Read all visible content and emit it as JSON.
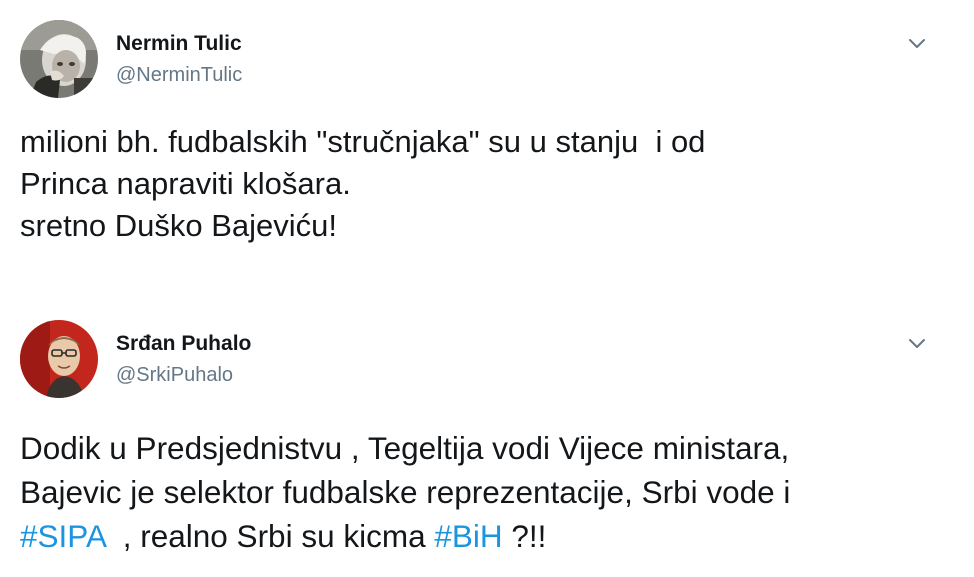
{
  "tweets": [
    {
      "name": "Nermin Tulic",
      "handle": "@NerminTulic",
      "lines": [
        "milioni bh. fudbalskih \"stručnjaka\" su u stanju  i od",
        "Princa napraviti klošara.",
        "sretno Duško Bajeviću!"
      ],
      "menu_icon": "chevron-down-icon"
    },
    {
      "name": "Srđan Puhalo",
      "handle": "@SrkiPuhalo",
      "lines": [
        "Dodik u Predsjednistvu , Tegeltija vodi Vijece ministara,",
        "Bajevic je selektor fudbalske reprezentacije, Srbi vode i"
      ],
      "last_line": {
        "hashtag1": "#SIPA",
        "text1": "  , realno Srbi su kicma ",
        "hashtag2": "#BiH",
        "text2": " ?!!"
      },
      "menu_icon": "chevron-down-icon"
    }
  ],
  "colors": {
    "name": "#14171a",
    "handle": "#657786",
    "hashtag": "#1b95e0",
    "chevron": "#657786"
  }
}
